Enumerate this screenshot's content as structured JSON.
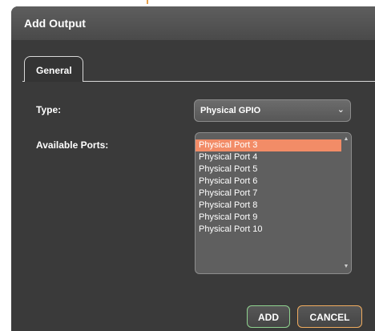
{
  "dialog": {
    "title": "Add Output"
  },
  "tabs": [
    {
      "label": "General",
      "active": true
    }
  ],
  "fields": {
    "type": {
      "label": "Type:",
      "value": "Physical GPIO"
    },
    "available_ports": {
      "label": "Available Ports:",
      "items": [
        "Physical Port 3",
        "Physical Port 4",
        "Physical Port 5",
        "Physical Port 6",
        "Physical Port 7",
        "Physical Port 8",
        "Physical Port 9",
        "Physical Port 10"
      ],
      "selected": "Physical Port 3"
    }
  },
  "actions": {
    "add_label": "ADD",
    "cancel_label": "CANCEL"
  },
  "icons": {
    "type_select": "chevron-down-icon",
    "scroll_up": "scroll-up-arrow-icon",
    "scroll_down": "scroll-down-arrow-icon"
  },
  "colors": {
    "dialog_background": "#3b3b3b",
    "titlebar": "#545454",
    "selection": "#f28c67",
    "add_border": "#8fd28f",
    "cancel_border": "#f0ac5f",
    "top_accent": "#e8a04a"
  }
}
